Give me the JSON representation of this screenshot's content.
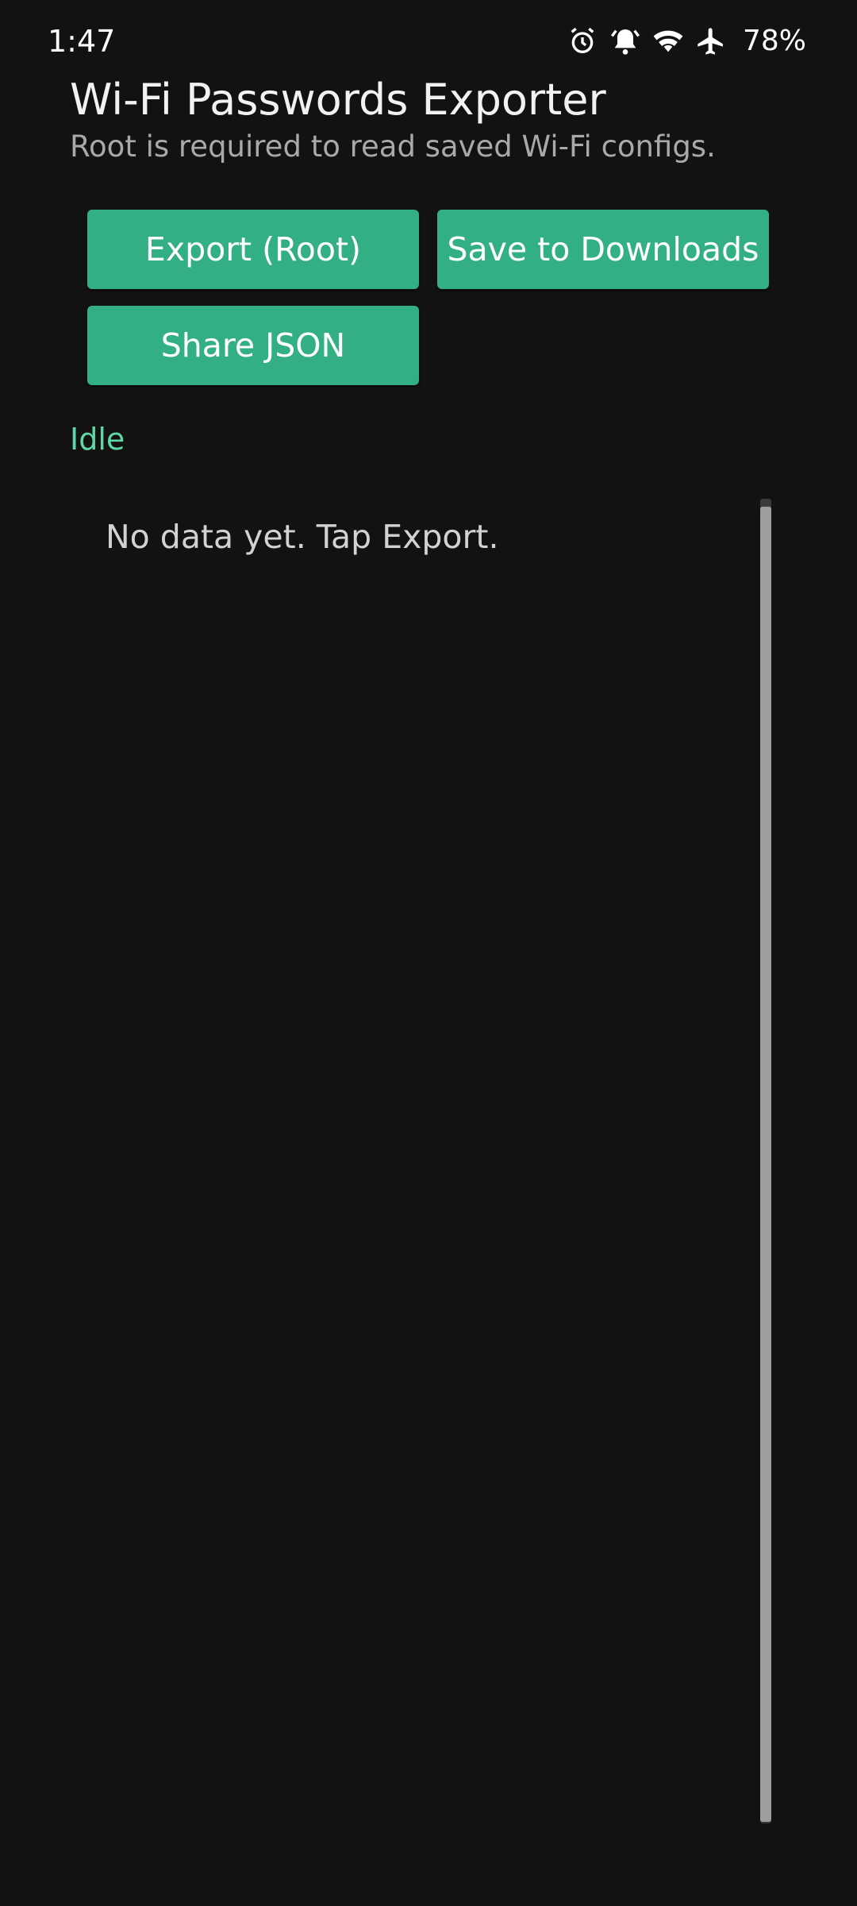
{
  "status_bar": {
    "time": "1:47",
    "icons": [
      "alarm-icon",
      "alarm-bell-icon",
      "wifi-icon",
      "airplane-icon"
    ],
    "battery": "78%"
  },
  "app": {
    "title": "Wi-Fi Passwords Exporter",
    "subtitle": "Root is required to read saved Wi-Fi configs."
  },
  "buttons": {
    "export": "Export (Root)",
    "save": "Save to Downloads",
    "share": "Share JSON"
  },
  "status": "Idle",
  "output": {
    "text": "No data yet. Tap Export."
  },
  "colors": {
    "background": "#121212",
    "accent": "#33b083",
    "status_text": "#5fd6a4"
  }
}
